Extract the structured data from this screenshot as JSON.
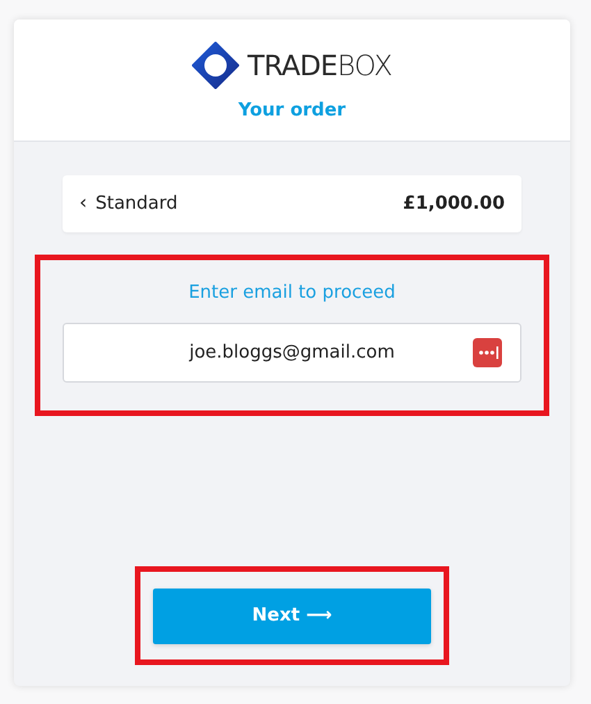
{
  "header": {
    "logo": "**TRADE**BOX",
    "title": "Your order"
  },
  "order": {
    "back": "‹",
    "plan": "Standard",
    "price": "£1,000.00"
  },
  "email": {
    "label": "Enter email to proceed",
    "value": "joe.bloggs@gmail.com",
    "highlighted": true
  },
  "next": {
    "label": "Next ⟶",
    "highlighted": true
  }
}
